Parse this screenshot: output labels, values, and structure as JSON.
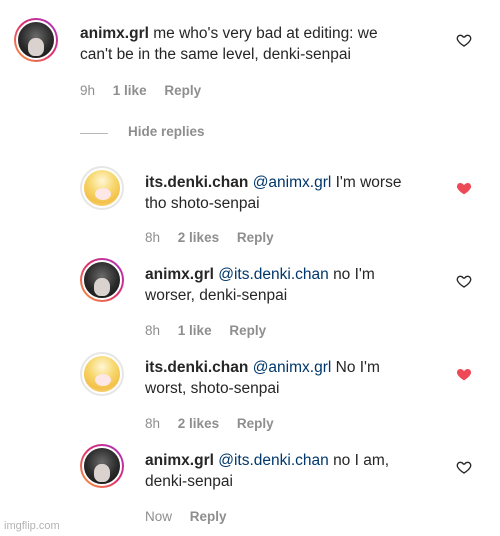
{
  "comments": [
    {
      "username": "animx.grl",
      "mention": "",
      "text_line1": "me who's very bad at editing: we",
      "text_line2": "can't be in the same level, denki-senpai",
      "time": "9h",
      "likes": "1 like",
      "reply": "Reply",
      "liked": false,
      "avatar_icon": "dark-hair-avatar"
    },
    {
      "username": "its.denki.chan",
      "mention": "@animx.grl",
      "text_line1": "I'm worse",
      "text_line2": "tho shoto-senpai",
      "time": "8h",
      "likes": "2 likes",
      "reply": "Reply",
      "liked": true,
      "avatar_icon": "blond-hair-avatar"
    },
    {
      "username": "animx.grl",
      "mention": "@its.denki.chan",
      "text_line1": "no I'm",
      "text_line2": "worser, denki-senpai",
      "time": "8h",
      "likes": "1 like",
      "reply": "Reply",
      "liked": false,
      "avatar_icon": "dark-hair-avatar"
    },
    {
      "username": "its.denki.chan",
      "mention": "@animx.grl",
      "text_line1": "No I'm",
      "text_line2": "worst, shoto-senpai",
      "time": "8h",
      "likes": "2 likes",
      "reply": "Reply",
      "liked": true,
      "avatar_icon": "blond-hair-avatar"
    },
    {
      "username": "animx.grl",
      "mention": "@its.denki.chan",
      "text_line1": "no I am,",
      "text_line2": "denki-senpai",
      "time": "Now",
      "likes": "",
      "reply": "Reply",
      "liked": false,
      "avatar_icon": "dark-hair-avatar"
    }
  ],
  "hide_replies_label": "Hide replies",
  "watermark": "imgflip.com",
  "colors": {
    "liked_heart": "#ed4956",
    "mention": "#00376b",
    "meta_gray": "#8e8e8e"
  }
}
